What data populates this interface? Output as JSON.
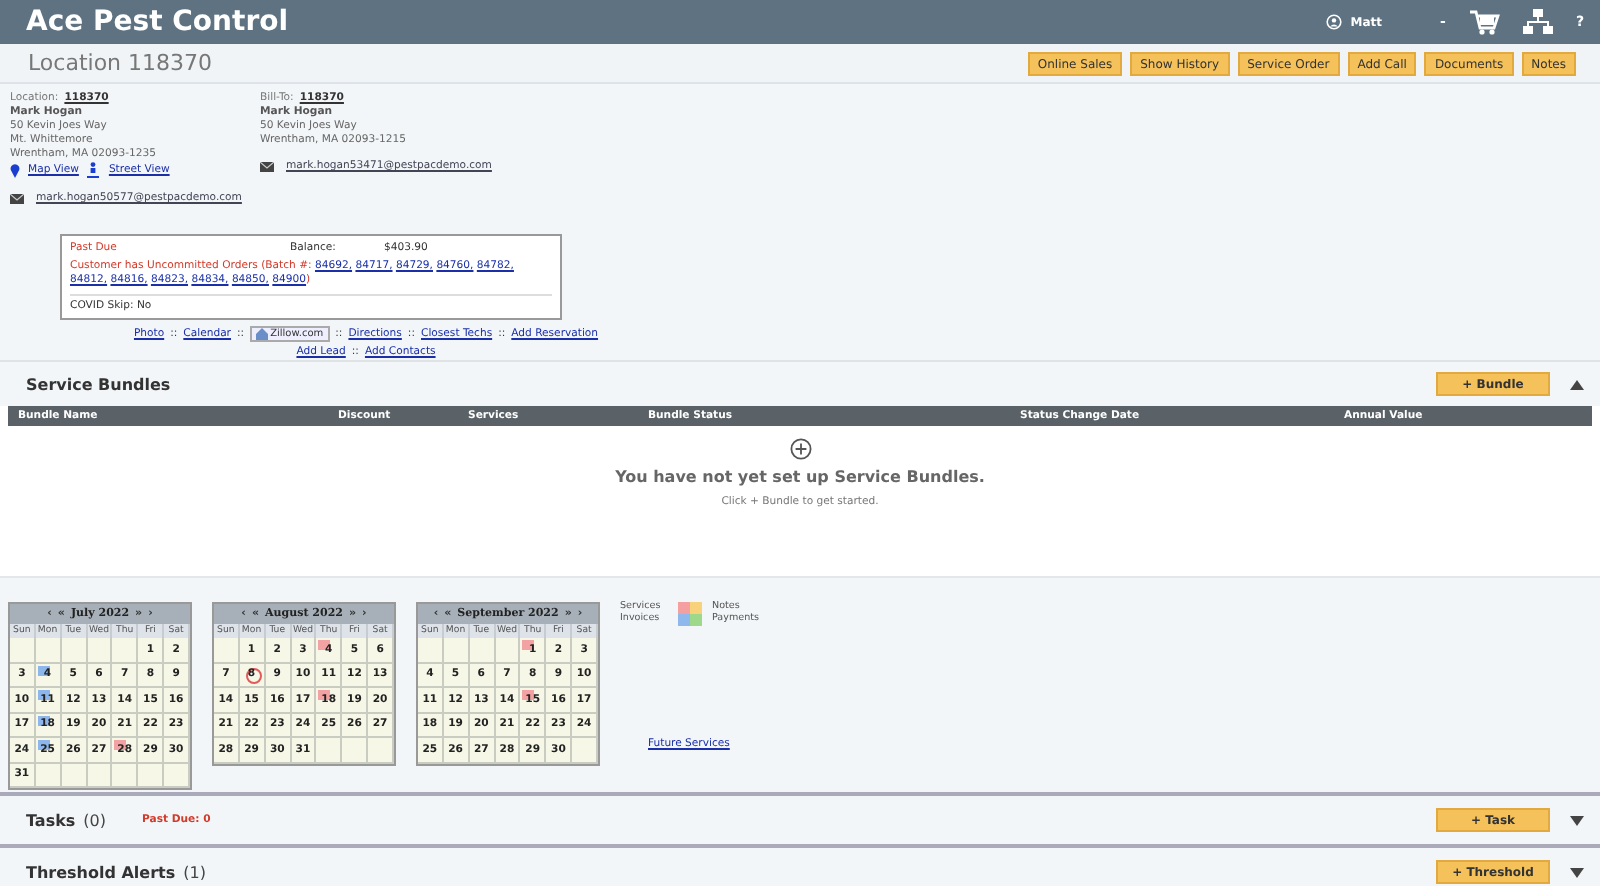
{
  "app": {
    "title": "Ace Pest Control",
    "user": "Matt",
    "menu_sep": "-",
    "help": "?"
  },
  "page": {
    "title": "Location 118370",
    "buttons": [
      "Online Sales",
      "Show History",
      "Service Order",
      "Add Call",
      "Documents",
      "Notes"
    ]
  },
  "location": {
    "label": "Location:",
    "number": "118370",
    "name": "Mark Hogan",
    "lines": [
      "50 Kevin Joes Way",
      "Mt. Whittemore",
      "Wrentham, MA 02093-1235"
    ],
    "map_link": "Map View",
    "street_link": "Street View",
    "email": "mark.hogan50577@pestpacdemo.com"
  },
  "bill_to": {
    "label": "Bill-To:",
    "number": "118370",
    "name": "Mark Hogan",
    "lines": [
      "50 Kevin Joes Way",
      "Wrentham, MA 02093-1215"
    ],
    "email": "mark.hogan53471@pestpacdemo.com"
  },
  "alert": {
    "past_due": "Past Due",
    "balance_label": "Balance:",
    "balance": "$403.90",
    "orders_text": "Customer has Uncommitted Orders (Batch #:",
    "orders": [
      "84692,",
      "84717,",
      "84729,",
      "84760,",
      "84782,",
      "84812,",
      "84816,",
      "84823,",
      "84834,",
      "84850,",
      "84900"
    ],
    "orders_close": ")",
    "covid": "COVID Skip: No"
  },
  "links": [
    [
      {
        "kind": "link",
        "text": "Photo"
      },
      {
        "kind": "link",
        "text": "Calendar"
      },
      {
        "kind": "badge",
        "text": "Zillow.com"
      },
      {
        "kind": "link",
        "text": "Directions"
      },
      {
        "kind": "link",
        "text": "Closest Techs"
      },
      {
        "kind": "link",
        "text": "Add Reservation"
      }
    ],
    [
      {
        "kind": "link",
        "text": "Add Lead"
      },
      {
        "kind": "link",
        "text": "Add Contacts"
      }
    ]
  ],
  "link_sep": "::",
  "bundles": {
    "title": "Service Bundles",
    "button": "+ Bundle",
    "expanded": true,
    "columns": [
      "Bundle Name",
      "Discount",
      "Services",
      "Bundle Status",
      "Status Change Date",
      "Annual Value"
    ],
    "empty_title": "You have not yet set up Service Bundles.",
    "empty_hint": "Click + Bundle to get started."
  },
  "months": [
    {
      "nav": {
        "prev": "‹",
        "prev_year": "«",
        "next_year": "»",
        "next": "›"
      },
      "title": "July 2022",
      "weekdays": [
        "Sun",
        "Mon",
        "Tue",
        "Wed",
        "Thu",
        "Fri",
        "Sat"
      ],
      "weeks": [
        [
          {
            "kind": "blank"
          },
          {
            "kind": "blank"
          },
          {
            "kind": "blank"
          },
          {
            "kind": "blank"
          },
          {
            "kind": "blank"
          },
          {
            "kind": "day",
            "day": "1"
          },
          {
            "kind": "day",
            "day": "2"
          }
        ],
        [
          {
            "kind": "day",
            "day": "3"
          },
          {
            "kind": "day",
            "day": "4",
            "color": "#8db6ea"
          },
          {
            "kind": "day",
            "day": "5"
          },
          {
            "kind": "day",
            "day": "6"
          },
          {
            "kind": "day",
            "day": "7"
          },
          {
            "kind": "day",
            "day": "8"
          },
          {
            "kind": "day",
            "day": "9"
          }
        ],
        [
          {
            "kind": "day",
            "day": "10"
          },
          {
            "kind": "day",
            "day": "11",
            "color": "#8db6ea"
          },
          {
            "kind": "day",
            "day": "12"
          },
          {
            "kind": "day",
            "day": "13"
          },
          {
            "kind": "day",
            "day": "14"
          },
          {
            "kind": "day",
            "day": "15"
          },
          {
            "kind": "day",
            "day": "16"
          }
        ],
        [
          {
            "kind": "day",
            "day": "17"
          },
          {
            "kind": "day",
            "day": "18",
            "color": "#8db6ea"
          },
          {
            "kind": "day",
            "day": "19"
          },
          {
            "kind": "day",
            "day": "20"
          },
          {
            "kind": "day",
            "day": "21"
          },
          {
            "kind": "day",
            "day": "22"
          },
          {
            "kind": "day",
            "day": "23"
          }
        ],
        [
          {
            "kind": "day",
            "day": "24"
          },
          {
            "kind": "day",
            "day": "25",
            "color": "#8db6ea"
          },
          {
            "kind": "day",
            "day": "26"
          },
          {
            "kind": "day",
            "day": "27"
          },
          {
            "kind": "day",
            "day": "28",
            "color": "#f2a2a2"
          },
          {
            "kind": "day",
            "day": "29"
          },
          {
            "kind": "day",
            "day": "30"
          }
        ],
        [
          {
            "kind": "day",
            "day": "31"
          },
          {
            "kind": "blank"
          },
          {
            "kind": "blank"
          },
          {
            "kind": "blank"
          },
          {
            "kind": "blank"
          },
          {
            "kind": "blank"
          },
          {
            "kind": "blank"
          }
        ]
      ]
    },
    {
      "nav": {
        "prev": "‹",
        "prev_year": "«",
        "next_year": "»",
        "next": "›"
      },
      "title": "August 2022",
      "weekdays": [
        "Sun",
        "Mon",
        "Tue",
        "Wed",
        "Thu",
        "Fri",
        "Sat"
      ],
      "weeks": [
        [
          {
            "kind": "blank"
          },
          {
            "kind": "day",
            "day": "1"
          },
          {
            "kind": "day",
            "day": "2"
          },
          {
            "kind": "day",
            "day": "3"
          },
          {
            "kind": "day",
            "day": "4",
            "color": "#f2a2a2"
          },
          {
            "kind": "day",
            "day": "5"
          },
          {
            "kind": "day",
            "day": "6"
          }
        ],
        [
          {
            "kind": "day",
            "day": "7"
          },
          {
            "kind": "today",
            "day": "8"
          },
          {
            "kind": "day",
            "day": "9"
          },
          {
            "kind": "day",
            "day": "10"
          },
          {
            "kind": "day",
            "day": "11"
          },
          {
            "kind": "day",
            "day": "12"
          },
          {
            "kind": "day",
            "day": "13"
          }
        ],
        [
          {
            "kind": "day",
            "day": "14"
          },
          {
            "kind": "day",
            "day": "15"
          },
          {
            "kind": "day",
            "day": "16"
          },
          {
            "kind": "day",
            "day": "17"
          },
          {
            "kind": "day",
            "day": "18",
            "color": "#f2a2a2"
          },
          {
            "kind": "day",
            "day": "19"
          },
          {
            "kind": "day",
            "day": "20"
          }
        ],
        [
          {
            "kind": "day",
            "day": "21"
          },
          {
            "kind": "day",
            "day": "22"
          },
          {
            "kind": "day",
            "day": "23"
          },
          {
            "kind": "day",
            "day": "24"
          },
          {
            "kind": "day",
            "day": "25"
          },
          {
            "kind": "day",
            "day": "26"
          },
          {
            "kind": "day",
            "day": "27"
          }
        ],
        [
          {
            "kind": "day",
            "day": "28"
          },
          {
            "kind": "day",
            "day": "29"
          },
          {
            "kind": "day",
            "day": "30"
          },
          {
            "kind": "day",
            "day": "31"
          },
          {
            "kind": "blank"
          },
          {
            "kind": "blank"
          },
          {
            "kind": "blank"
          }
        ]
      ]
    },
    {
      "nav": {
        "prev": "‹",
        "prev_year": "«",
        "next_year": "»",
        "next": "›"
      },
      "title": "September 2022",
      "weekdays": [
        "Sun",
        "Mon",
        "Tue",
        "Wed",
        "Thu",
        "Fri",
        "Sat"
      ],
      "weeks": [
        [
          {
            "kind": "blank"
          },
          {
            "kind": "blank"
          },
          {
            "kind": "blank"
          },
          {
            "kind": "blank"
          },
          {
            "kind": "day",
            "day": "1",
            "color": "#f2a2a2"
          },
          {
            "kind": "day",
            "day": "2"
          },
          {
            "kind": "day",
            "day": "3"
          }
        ],
        [
          {
            "kind": "day",
            "day": "4"
          },
          {
            "kind": "day",
            "day": "5"
          },
          {
            "kind": "day",
            "day": "6"
          },
          {
            "kind": "day",
            "day": "7"
          },
          {
            "kind": "day",
            "day": "8"
          },
          {
            "kind": "day",
            "day": "9"
          },
          {
            "kind": "day",
            "day": "10"
          }
        ],
        [
          {
            "kind": "day",
            "day": "11"
          },
          {
            "kind": "day",
            "day": "12"
          },
          {
            "kind": "day",
            "day": "13"
          },
          {
            "kind": "day",
            "day": "14"
          },
          {
            "kind": "day",
            "day": "15",
            "color": "#f2a2a2"
          },
          {
            "kind": "day",
            "day": "16"
          },
          {
            "kind": "day",
            "day": "17"
          }
        ],
        [
          {
            "kind": "day",
            "day": "18"
          },
          {
            "kind": "day",
            "day": "19"
          },
          {
            "kind": "day",
            "day": "20"
          },
          {
            "kind": "day",
            "day": "21"
          },
          {
            "kind": "day",
            "day": "22"
          },
          {
            "kind": "day",
            "day": "23"
          },
          {
            "kind": "day",
            "day": "24"
          }
        ],
        [
          {
            "kind": "day",
            "day": "25"
          },
          {
            "kind": "day",
            "day": "26"
          },
          {
            "kind": "day",
            "day": "27"
          },
          {
            "kind": "day",
            "day": "28"
          },
          {
            "kind": "day",
            "day": "29"
          },
          {
            "kind": "day",
            "day": "30"
          },
          {
            "kind": "blank"
          }
        ]
      ]
    }
  ],
  "legend": {
    "left": [
      "Services",
      "Invoices"
    ],
    "right": [
      "Notes",
      "Payments"
    ]
  },
  "future_link": "Future Services",
  "sections": [
    {
      "title": "Tasks",
      "count": "(0)",
      "note": "Past Due: 0",
      "button": "+ Task",
      "expanded": false
    },
    {
      "title": "Threshold Alerts",
      "count": "(1)",
      "button": "+ Threshold",
      "expanded": false
    }
  ]
}
